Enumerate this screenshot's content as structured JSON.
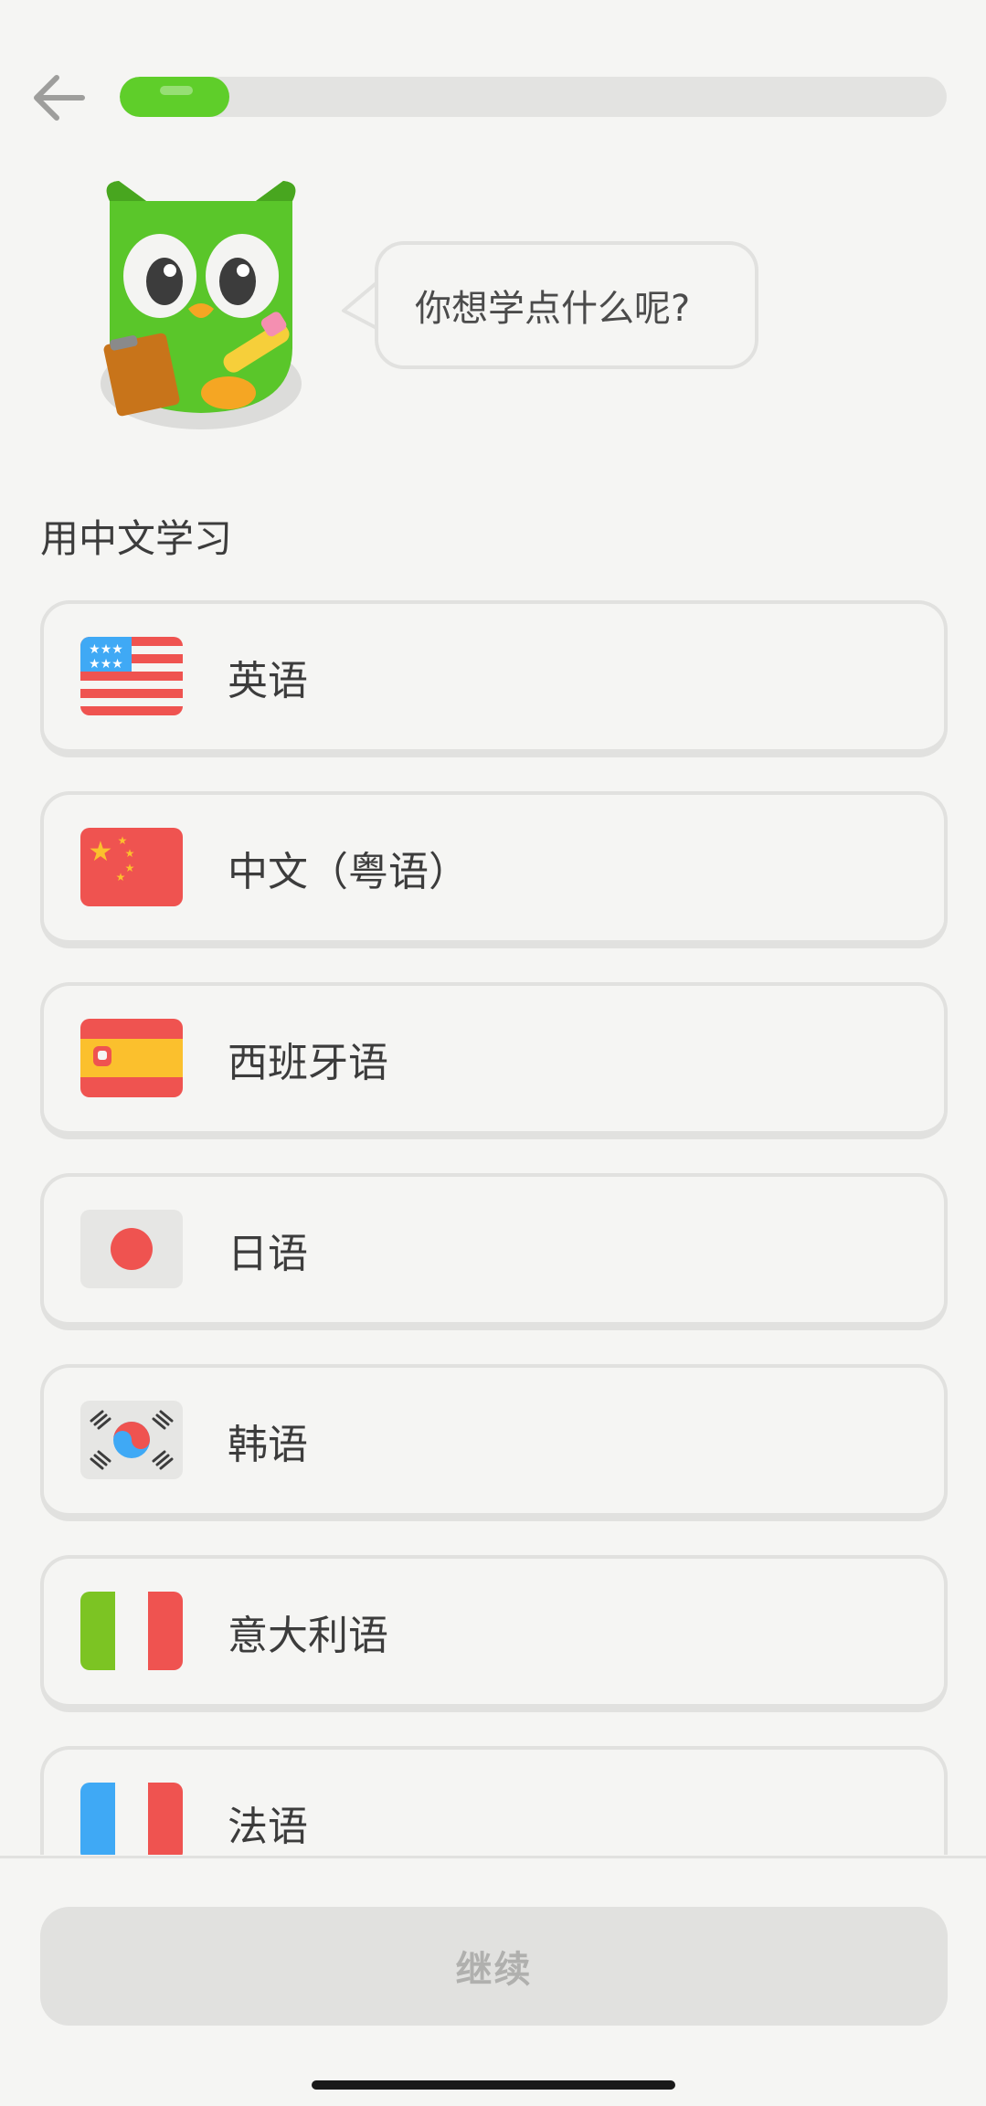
{
  "header": {
    "back_icon": "arrow-left-icon",
    "progress": {
      "fraction": 0.133,
      "color": "#5fce2a"
    }
  },
  "mascot": {
    "icon": "owl-mascot-icon"
  },
  "speech_bubble": {
    "text": "你想学点什么呢?"
  },
  "section_title": "用中文学习",
  "languages": [
    {
      "label": "英语",
      "flag": "us-flag-icon"
    },
    {
      "label": "中文（粤语）",
      "flag": "china-flag-icon"
    },
    {
      "label": "西班牙语",
      "flag": "spain-flag-icon"
    },
    {
      "label": "日语",
      "flag": "japan-flag-icon"
    },
    {
      "label": "韩语",
      "flag": "korea-flag-icon"
    },
    {
      "label": "意大利语",
      "flag": "italy-flag-icon"
    },
    {
      "label": "法语",
      "flag": "france-flag-icon"
    }
  ],
  "footer": {
    "continue_label": "继续"
  }
}
